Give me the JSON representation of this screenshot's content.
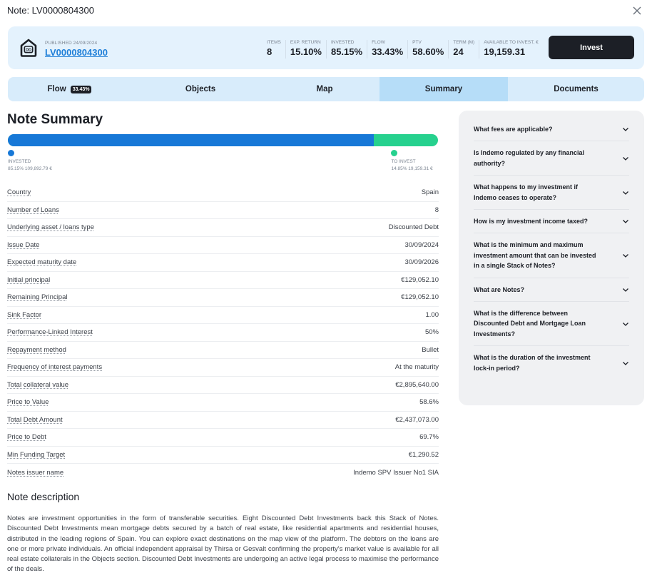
{
  "window": {
    "title": "Note: LV0000804300",
    "close_icon": "close-icon"
  },
  "header": {
    "logo_icon": "house-dd-icon",
    "published_label": "PUBLISHED 24/09/2024",
    "note_id": "LV0000804300",
    "stats": [
      {
        "label": "ITEMS",
        "value": "8"
      },
      {
        "label": "EXP. RETURN",
        "value": "15.10%"
      },
      {
        "label": "INVESTED",
        "value": "85.15%"
      },
      {
        "label": "FLOW",
        "value": "33.43%"
      },
      {
        "label": "PTV",
        "value": "58.60%"
      },
      {
        "label": "TERM (M)",
        "value": "24"
      },
      {
        "label": "AVAILABLE TO INVEST, €",
        "value": "19,159.31"
      }
    ],
    "invest_label": "Invest"
  },
  "tabs": [
    {
      "label": "Flow",
      "badge": "33.43%",
      "active": false
    },
    {
      "label": "Objects",
      "active": false
    },
    {
      "label": "Map",
      "active": false
    },
    {
      "label": "Summary",
      "active": true
    },
    {
      "label": "Documents",
      "active": false
    }
  ],
  "summary": {
    "title": "Note Summary",
    "progress": {
      "invested_fraction": 0.8515,
      "invested_color": "#1778d7",
      "to_invest_color": "#26d18e",
      "invested_label": "INVESTED",
      "invested_value": "85.15% 109,892.79 €",
      "to_invest_label": "TO INVEST",
      "to_invest_value": "14.85% 19,159.31 €"
    },
    "details": [
      {
        "label": "Country",
        "value": "Spain"
      },
      {
        "label": "Number of Loans",
        "value": "8"
      },
      {
        "label": "Underlying asset / loans type",
        "value": "Discounted Debt"
      },
      {
        "label": "Issue Date",
        "value": "30/09/2024"
      },
      {
        "label": "Expected maturity date",
        "value": "30/09/2026"
      },
      {
        "label": "Initial principal",
        "value": "€129,052.10"
      },
      {
        "label": "Remaining Principal",
        "value": "€129,052.10"
      },
      {
        "label": "Sink Factor",
        "value": "1.00"
      },
      {
        "label": "Performance-Linked Interest",
        "value": "50%"
      },
      {
        "label": "Repayment method",
        "value": "Bullet"
      },
      {
        "label": "Frequency of interest payments",
        "value": "At the maturity"
      },
      {
        "label": "Total collateral value",
        "value": "€2,895,640.00"
      },
      {
        "label": "Price to Value",
        "value": "58.6%"
      },
      {
        "label": "Total Debt Amount",
        "value": "€2,437,073.00"
      },
      {
        "label": "Price to Debt",
        "value": "69.7%"
      },
      {
        "label": "Min Funding Target",
        "value": "€1,290.52"
      },
      {
        "label": "Notes issuer name",
        "value": "Indemo SPV Issuer No1 SIA"
      }
    ]
  },
  "description": {
    "title": "Note description",
    "text": "Notes are investment opportunities in the form of transferable securities. Eight Discounted Debt Investments back this Stack of Notes. Discounted Debt Investments mean mortgage debts secured by a batch of real estate, like residential apartments and residential houses, distributed in the leading regions of Spain. You can explore exact destinations on the map view of the platform. The debtors on the loans are one or more private individuals. An official independent appraisal by Thirsa or Gesvalt confirming the property's market value is available for all real estate collaterals in the Objects section. Discounted Debt Investments are undergoing an active legal process to maximise the performance of the deals."
  },
  "faq": [
    {
      "question": "What fees are applicable?"
    },
    {
      "question": "Is Indemo regulated by any financial authority?"
    },
    {
      "question": "What happens to my investment if Indemo ceases to operate?"
    },
    {
      "question": "How is my investment income taxed?"
    },
    {
      "question": "What is the minimum and maximum investment amount that can be invested in a single Stack of Notes?"
    },
    {
      "question": "What are Notes?"
    },
    {
      "question": "What is the difference between Discounted Debt and Mortgage Loan Investments?"
    },
    {
      "question": "What is the duration of the investment lock-in period?"
    }
  ]
}
